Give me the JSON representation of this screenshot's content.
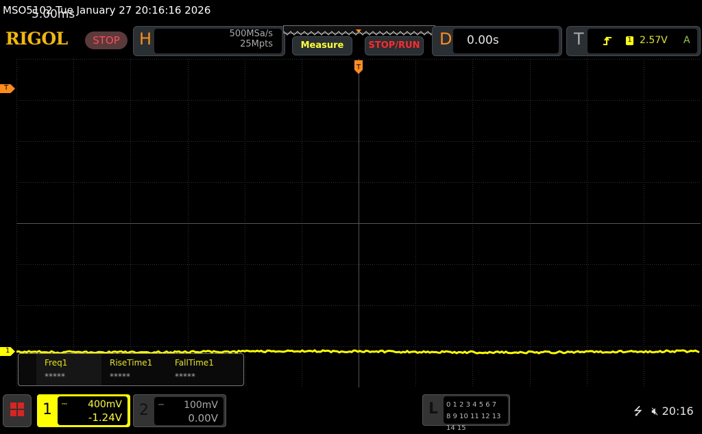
{
  "title": "MSO5102  Tue January 27 20:16:16 2026",
  "logo": "RIGOL",
  "run_state": "STOP",
  "horizontal": {
    "label": "H",
    "timebase": "5.00ms",
    "sample_rate": "500MSa/s",
    "memory_depth": "25Mpts"
  },
  "buttons": {
    "measure": "Measure",
    "stop_run": "STOP/RUN"
  },
  "delay": {
    "label": "D",
    "value": "0.00s"
  },
  "trigger": {
    "label": "T",
    "source": "1",
    "level": "2.57V",
    "mode": "A",
    "slope_icon": "rising-edge-icon"
  },
  "markers": {
    "trigger_top": "T",
    "trigger_level": "T",
    "ch1": "1"
  },
  "measurements": [
    {
      "label": "Freq1",
      "value": "*****"
    },
    {
      "label": "RiseTime1",
      "value": "*****"
    },
    {
      "label": "FallTime1",
      "value": "*****"
    }
  ],
  "channels": [
    {
      "number": "1",
      "scale": "400mV",
      "offset": "-1.24V",
      "color": "#ffff00",
      "active": true
    },
    {
      "number": "2",
      "scale": "100mV",
      "offset": "0.00V",
      "color": "#aaaaaa",
      "active": false
    }
  ],
  "logic": {
    "label": "L",
    "row1": "0 1 2 3  4 5 6 7",
    "row2": "8 9 10 11 12 13 14 15"
  },
  "status": {
    "usb_icon": "usb-icon",
    "mute_icon": "speaker-muted-icon",
    "time": "20:16"
  },
  "colors": {
    "trace": "#ffff00",
    "accent": "#ff8c1a",
    "stop": "#ff2a2a"
  }
}
